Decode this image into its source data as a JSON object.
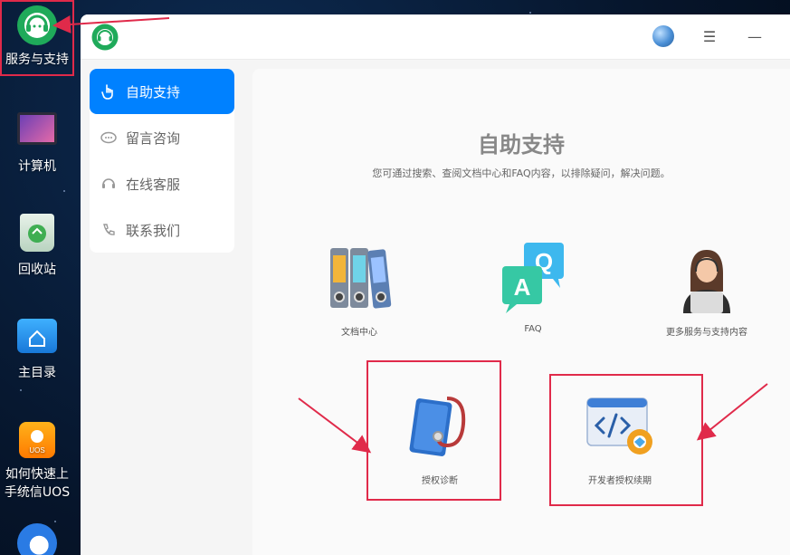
{
  "desktop": {
    "icons": [
      {
        "label": "服务与支持",
        "icon": "headset-icon"
      },
      {
        "label": "计算机",
        "icon": "computer-icon"
      },
      {
        "label": "回收站",
        "icon": "recycle-bin-icon"
      },
      {
        "label": "主目录",
        "icon": "home-folder-icon"
      },
      {
        "label": "如何快速上手统信UOS",
        "icon": "bulb-icon"
      },
      {
        "label": "",
        "icon": "browser-icon"
      }
    ]
  },
  "window": {
    "title_icon": "headset-icon",
    "controls": {
      "avatar": "globe-avatar-icon",
      "menu": "☰",
      "minimize": "—"
    },
    "sidebar": {
      "items": [
        {
          "label": "自助支持",
          "icon": "hand-pointer-icon",
          "active": true
        },
        {
          "label": "留言咨询",
          "icon": "message-icon",
          "active": false
        },
        {
          "label": "在线客服",
          "icon": "headset-icon",
          "active": false
        },
        {
          "label": "联系我们",
          "icon": "phone-icon",
          "active": false
        }
      ]
    },
    "main": {
      "title": "自助支持",
      "subtitle": "您可通过搜索、查阅文档中心和FAQ内容，以排除疑问，解决问题。",
      "cards": [
        {
          "label": "文档中心",
          "icon": "binders-icon"
        },
        {
          "label": "FAQ",
          "icon": "faq-bubbles-icon"
        },
        {
          "label": "更多服务与支持内容",
          "icon": "support-agent-icon"
        },
        {
          "label": "授权诊断",
          "icon": "stethoscope-icon"
        },
        {
          "label": "开发者授权续期",
          "icon": "code-gear-icon"
        }
      ]
    }
  },
  "colors": {
    "accent": "#0081ff",
    "highlight": "#e02a4a"
  }
}
